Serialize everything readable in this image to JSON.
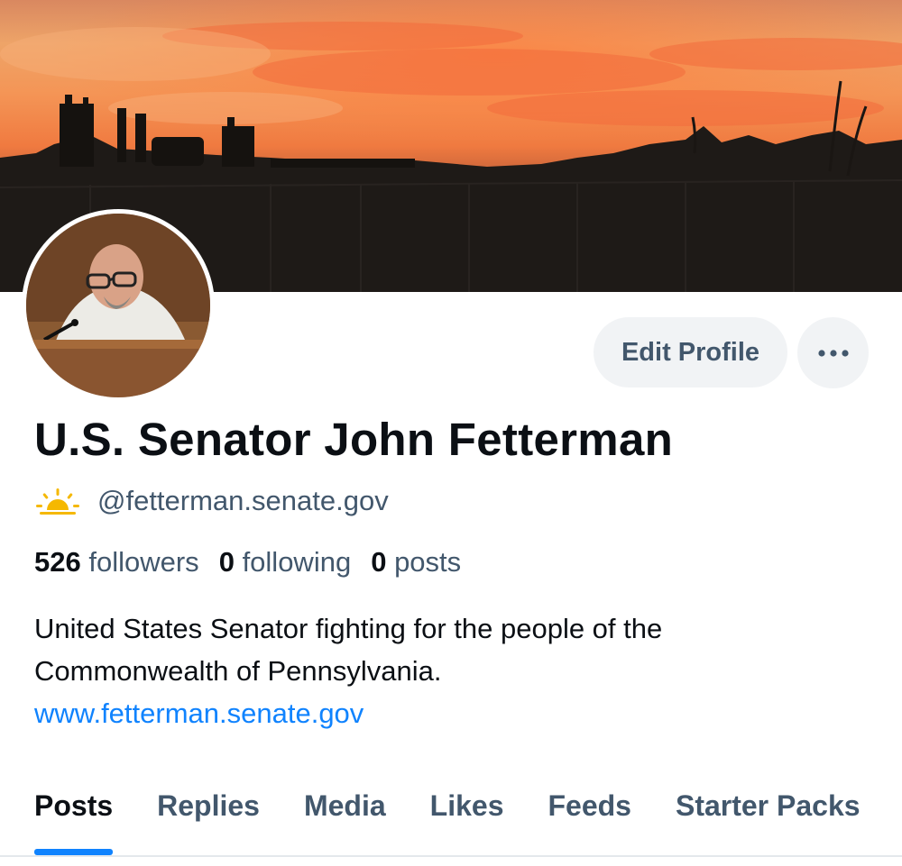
{
  "profile": {
    "display_name": "U.S. Senator John Fetterman",
    "handle": "@fetterman.senate.gov",
    "bio": "United States Senator fighting for the people of the Commonwealth of Pennsylvania.",
    "website": "www.fetterman.senate.gov",
    "banner_icon": "sunset-banner",
    "avatar_icon": "avatar-photo",
    "handle_badge_icon": "sunrise-icon"
  },
  "actions": {
    "edit_profile_label": "Edit Profile",
    "more_icon": "more-options-icon"
  },
  "stats": {
    "followers_count": "526",
    "followers_label": "followers",
    "following_count": "0",
    "following_label": "following",
    "posts_count": "0",
    "posts_label": "posts"
  },
  "tabs": [
    {
      "label": "Posts",
      "active": true
    },
    {
      "label": "Replies",
      "active": false
    },
    {
      "label": "Media",
      "active": false
    },
    {
      "label": "Likes",
      "active": false
    },
    {
      "label": "Feeds",
      "active": false
    },
    {
      "label": "Starter Packs",
      "active": false
    }
  ],
  "colors": {
    "accent": "#1083fe",
    "text_primary": "#0b0f14",
    "text_secondary": "#42576c",
    "button_bg": "#f1f3f5",
    "sun_yellow": "#f5b800"
  }
}
